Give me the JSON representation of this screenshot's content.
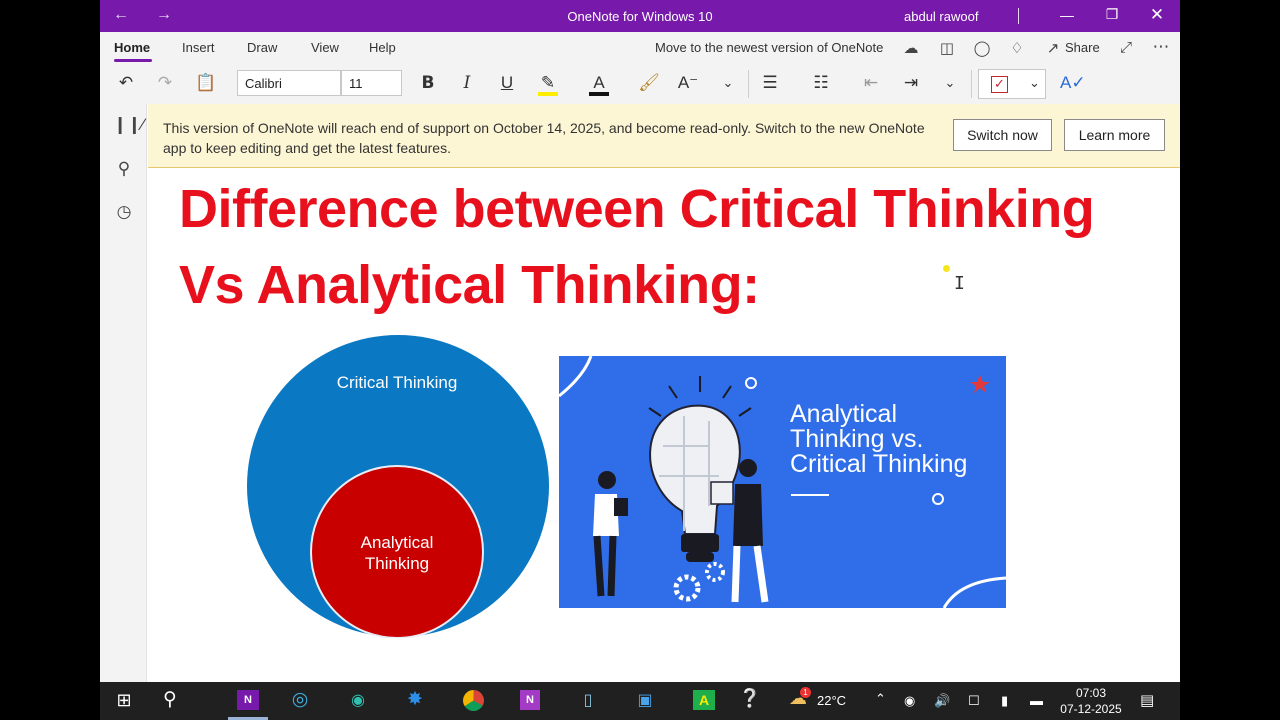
{
  "titlebar": {
    "title": "OneNote for Windows 10",
    "user": "abdul rawoof",
    "back_icon": "back-arrow-icon",
    "forward_icon": "forward-arrow-icon"
  },
  "menu": {
    "tabs": [
      "Home",
      "Insert",
      "Draw",
      "View",
      "Help"
    ],
    "active_tab": "Home",
    "upgrade_link": "Move to the newest version of OneNote",
    "share_label": "Share"
  },
  "toolbar": {
    "font_name": "Calibri",
    "font_size": "11",
    "bold": "B",
    "italic": "I",
    "underline": "U"
  },
  "banner": {
    "message": "This version of OneNote will reach end of support on October 14, 2025, and become read-only. Switch to the new OneNote app to keep editing and get the latest features.",
    "switch_label": "Switch now",
    "learn_label": "Learn more"
  },
  "page": {
    "heading_line1": "Difference between Critical Thinking",
    "heading_line2": "Vs Analytical Thinking:",
    "venn_outer": "Critical Thinking",
    "venn_inner_1": "Analytical",
    "venn_inner_2": "Thinking",
    "graphic_line1": "Analytical",
    "graphic_line2": "Thinking vs.",
    "graphic_line3": "Critical Thinking"
  },
  "colors": {
    "accent": "#7719aa",
    "heading": "#e8101c",
    "venn_outer": "#0a78c2",
    "venn_inner": "#c80000",
    "graphic_bg": "#2f6ee8",
    "banner_bg": "#fdf6d5"
  },
  "taskbar": {
    "weather": "22°C",
    "time": "07:03",
    "date": "07-12-2025",
    "mail_badge": "1"
  }
}
